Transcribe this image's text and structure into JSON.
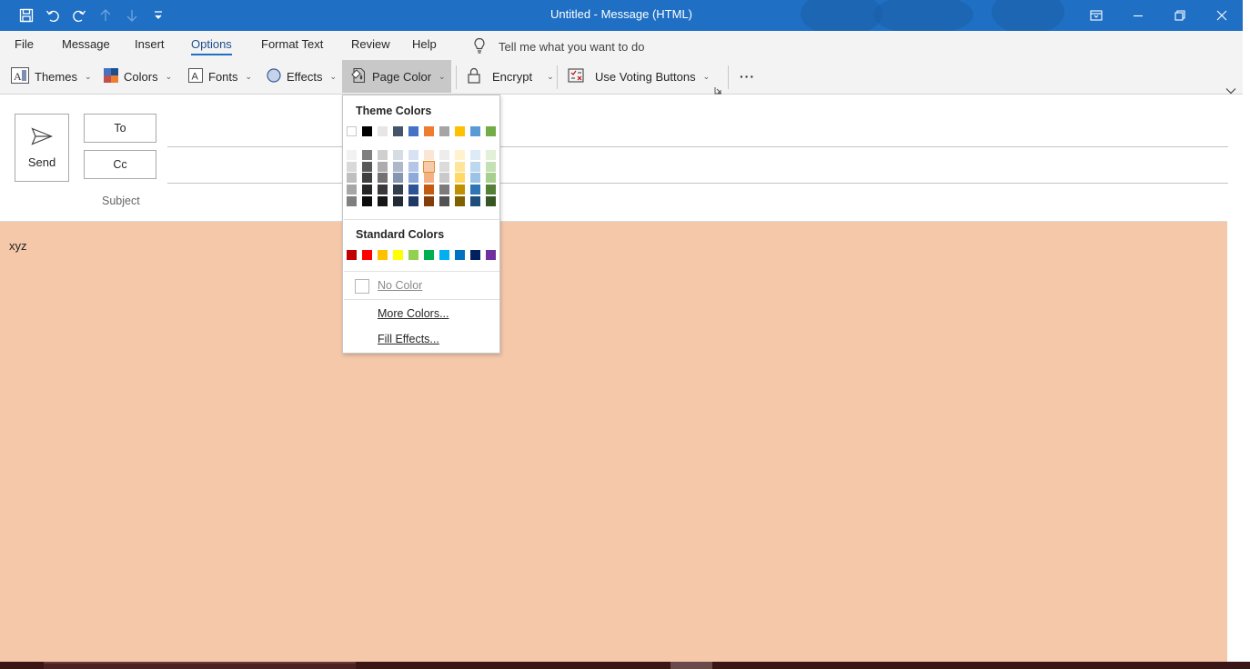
{
  "window": {
    "title": "Untitled  -  Message (HTML)"
  },
  "quick_access": [
    "save-icon",
    "undo-icon",
    "redo-icon",
    "previous-item-icon",
    "next-item-icon",
    "customize-toolbar-icon"
  ],
  "tabs": [
    "File",
    "Message",
    "Insert",
    "Options",
    "Format Text",
    "Review",
    "Help"
  ],
  "active_tab": "Options",
  "tell_me": {
    "icon": "lightbulb-icon",
    "placeholder": "Tell me what you want to do"
  },
  "ribbon": {
    "themes": "Themes",
    "colors": "Colors",
    "fonts": "Fonts",
    "effects": "Effects",
    "page_color": "Page Color",
    "encrypt": "Encrypt",
    "voting": "Use Voting Buttons",
    "more": "···"
  },
  "compose": {
    "send": "Send",
    "to": "To",
    "cc": "Cc",
    "subject": "Subject"
  },
  "body": {
    "text": "xyz",
    "background": "#f5c8aa"
  },
  "page_color_menu": {
    "theme_colors_heading": "Theme Colors",
    "theme_top_row": [
      "#ffffff",
      "#000000",
      "#e7e6e6",
      "#44546a",
      "#4472c4",
      "#ed7d31",
      "#a5a5a5",
      "#ffc000",
      "#5b9bd5",
      "#70ad47"
    ],
    "theme_shades": [
      [
        "#f2f2f2",
        "#d9d9d9",
        "#bfbfbf",
        "#a6a6a6",
        "#7f7f7f"
      ],
      [
        "#7f7f7f",
        "#595959",
        "#3f3f3f",
        "#262626",
        "#0d0d0d"
      ],
      [
        "#d0cece",
        "#aeabab",
        "#757171",
        "#3a3838",
        "#171616"
      ],
      [
        "#d6dce4",
        "#adb9ca",
        "#8496b0",
        "#323f4f",
        "#222a35"
      ],
      [
        "#d9e2f3",
        "#b4c6e7",
        "#8eaadb",
        "#2f5496",
        "#1f3864"
      ],
      [
        "#fbe5d5",
        "#f7caac",
        "#f4b183",
        "#c55a11",
        "#843c0b"
      ],
      [
        "#ededed",
        "#dbdbdb",
        "#c9c9c9",
        "#7b7b7b",
        "#525252"
      ],
      [
        "#fff2cc",
        "#fee599",
        "#ffd965",
        "#bf9000",
        "#7f6000"
      ],
      [
        "#deebf6",
        "#bdd7ee",
        "#9cc3e5",
        "#2e75b5",
        "#1e4e79"
      ],
      [
        "#e2efd9",
        "#c5e0b3",
        "#a8d08d",
        "#538135",
        "#375623"
      ]
    ],
    "selected_swatch": "#f7caac",
    "standard_colors_heading": "Standard Colors",
    "standard_colors": [
      "#c00000",
      "#ff0000",
      "#ffc000",
      "#ffff00",
      "#92d050",
      "#00b050",
      "#00b0f0",
      "#0070c0",
      "#002060",
      "#7030a0"
    ],
    "no_color": "No Color",
    "more_colors": "More Colors...",
    "fill_effects": "Fill Effects..."
  }
}
